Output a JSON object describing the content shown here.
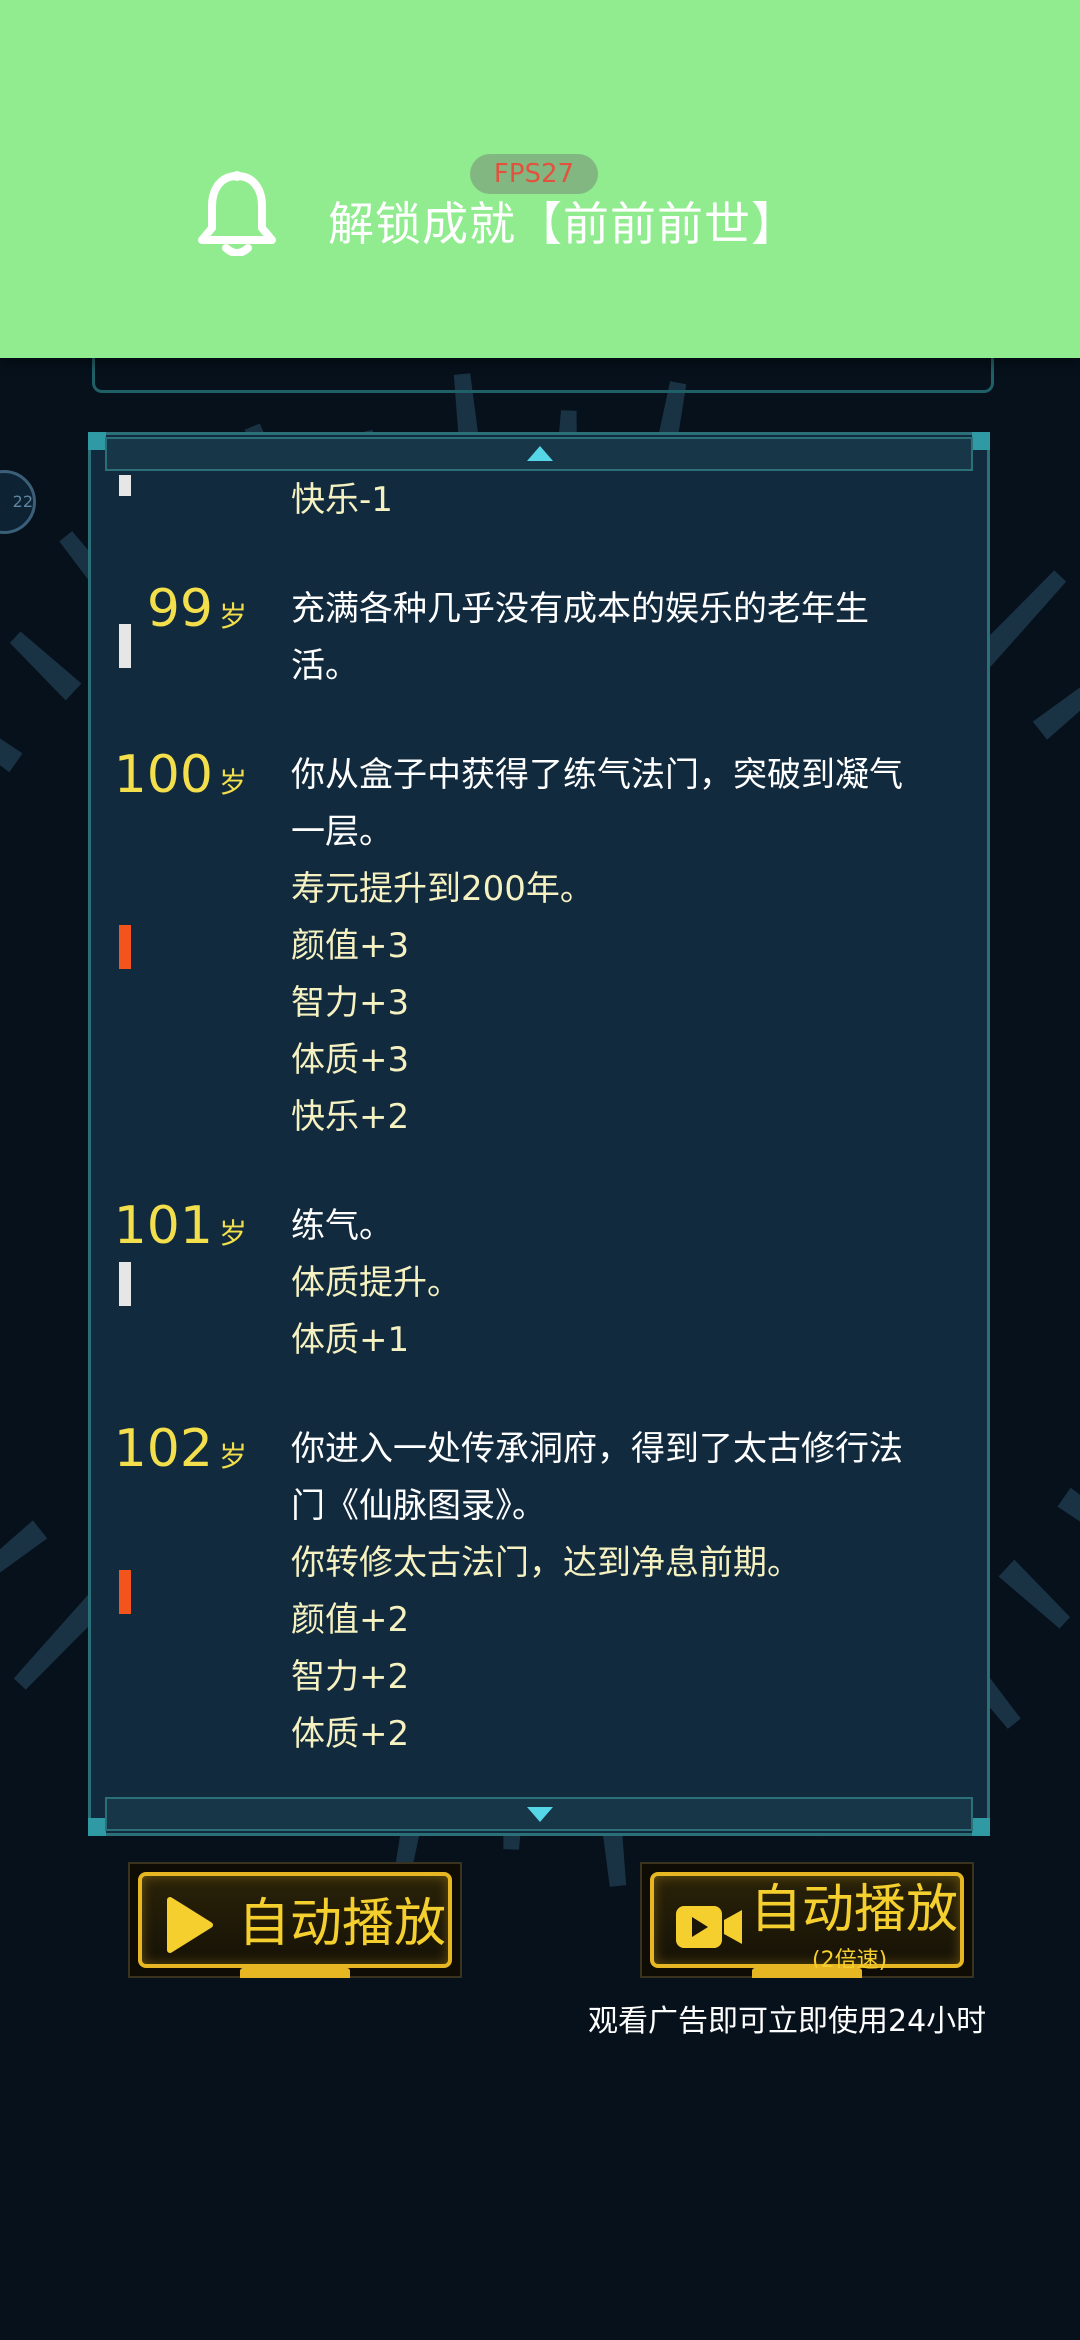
{
  "notification": {
    "icon": "bell-icon",
    "text": "解锁成就【前前前世】",
    "fps": "FPS27"
  },
  "side_badge": "22",
  "log": {
    "age_unit": "岁",
    "entries": [
      {
        "age": "",
        "marker": "white",
        "lines": [
          {
            "text": "快乐-1",
            "stat": true
          }
        ]
      },
      {
        "age": "99",
        "marker": "white",
        "lines": [
          {
            "text": "充满各种几乎没有成本的娱乐的老年生",
            "stat": false
          },
          {
            "text": "活。",
            "stat": false
          }
        ]
      },
      {
        "age": "100",
        "marker": "orange",
        "lines": [
          {
            "text": "你从盒子中获得了练气法门，突破到凝气",
            "stat": false
          },
          {
            "text": "一层。",
            "stat": false
          },
          {
            "text": "寿元提升到200年。",
            "stat": true
          },
          {
            "text": "颜值+3",
            "stat": true
          },
          {
            "text": "智力+3",
            "stat": true
          },
          {
            "text": "体质+3",
            "stat": true
          },
          {
            "text": "快乐+2",
            "stat": true
          }
        ]
      },
      {
        "age": "101",
        "marker": "white",
        "lines": [
          {
            "text": "练气。",
            "stat": false
          },
          {
            "text": "体质提升。",
            "stat": true
          },
          {
            "text": "体质+1",
            "stat": true
          }
        ]
      },
      {
        "age": "102",
        "marker": "orange",
        "lines": [
          {
            "text": "你进入一处传承洞府，得到了太古修行法",
            "stat": false
          },
          {
            "text": "门《仙脉图录》。",
            "stat": false
          },
          {
            "text": "你转修太古法门，达到净息前期。",
            "stat": true
          },
          {
            "text": "颜值+2",
            "stat": true
          },
          {
            "text": "智力+2",
            "stat": true
          },
          {
            "text": "体质+2",
            "stat": true
          }
        ]
      }
    ]
  },
  "buttons": {
    "auto_play": {
      "label": "自动播放",
      "icon": "play-icon"
    },
    "auto_play_2x": {
      "label": "自动播放",
      "sub": "(2倍速)",
      "icon": "video-camera-icon"
    }
  },
  "ad_note": "观看广告即可立即使用24小时",
  "colors": {
    "banner": "#90ec8f",
    "panel": "#122a3e",
    "age": "#f3df4b",
    "accent_gold": "#e7b723",
    "marker_white": "#e6e6e6",
    "marker_orange": "#f2541b"
  }
}
